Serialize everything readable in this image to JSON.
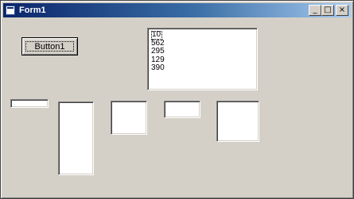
{
  "window": {
    "title": "Form1",
    "controls": {
      "minimize": "_",
      "maximize": "□",
      "close": "×"
    }
  },
  "button": {
    "label": "Button1"
  },
  "listbox": {
    "items": [
      "10",
      "562",
      "295",
      "129",
      "390"
    ],
    "selected_index": 0
  },
  "icons": {
    "app": "form-icon",
    "minimize": "minimize-icon",
    "maximize": "maximize-icon",
    "close": "close-icon"
  },
  "colors": {
    "face": "#d4d0c8",
    "titlebar_start": "#0a246a",
    "titlebar_end": "#a6caf0",
    "field": "#ffffff"
  }
}
